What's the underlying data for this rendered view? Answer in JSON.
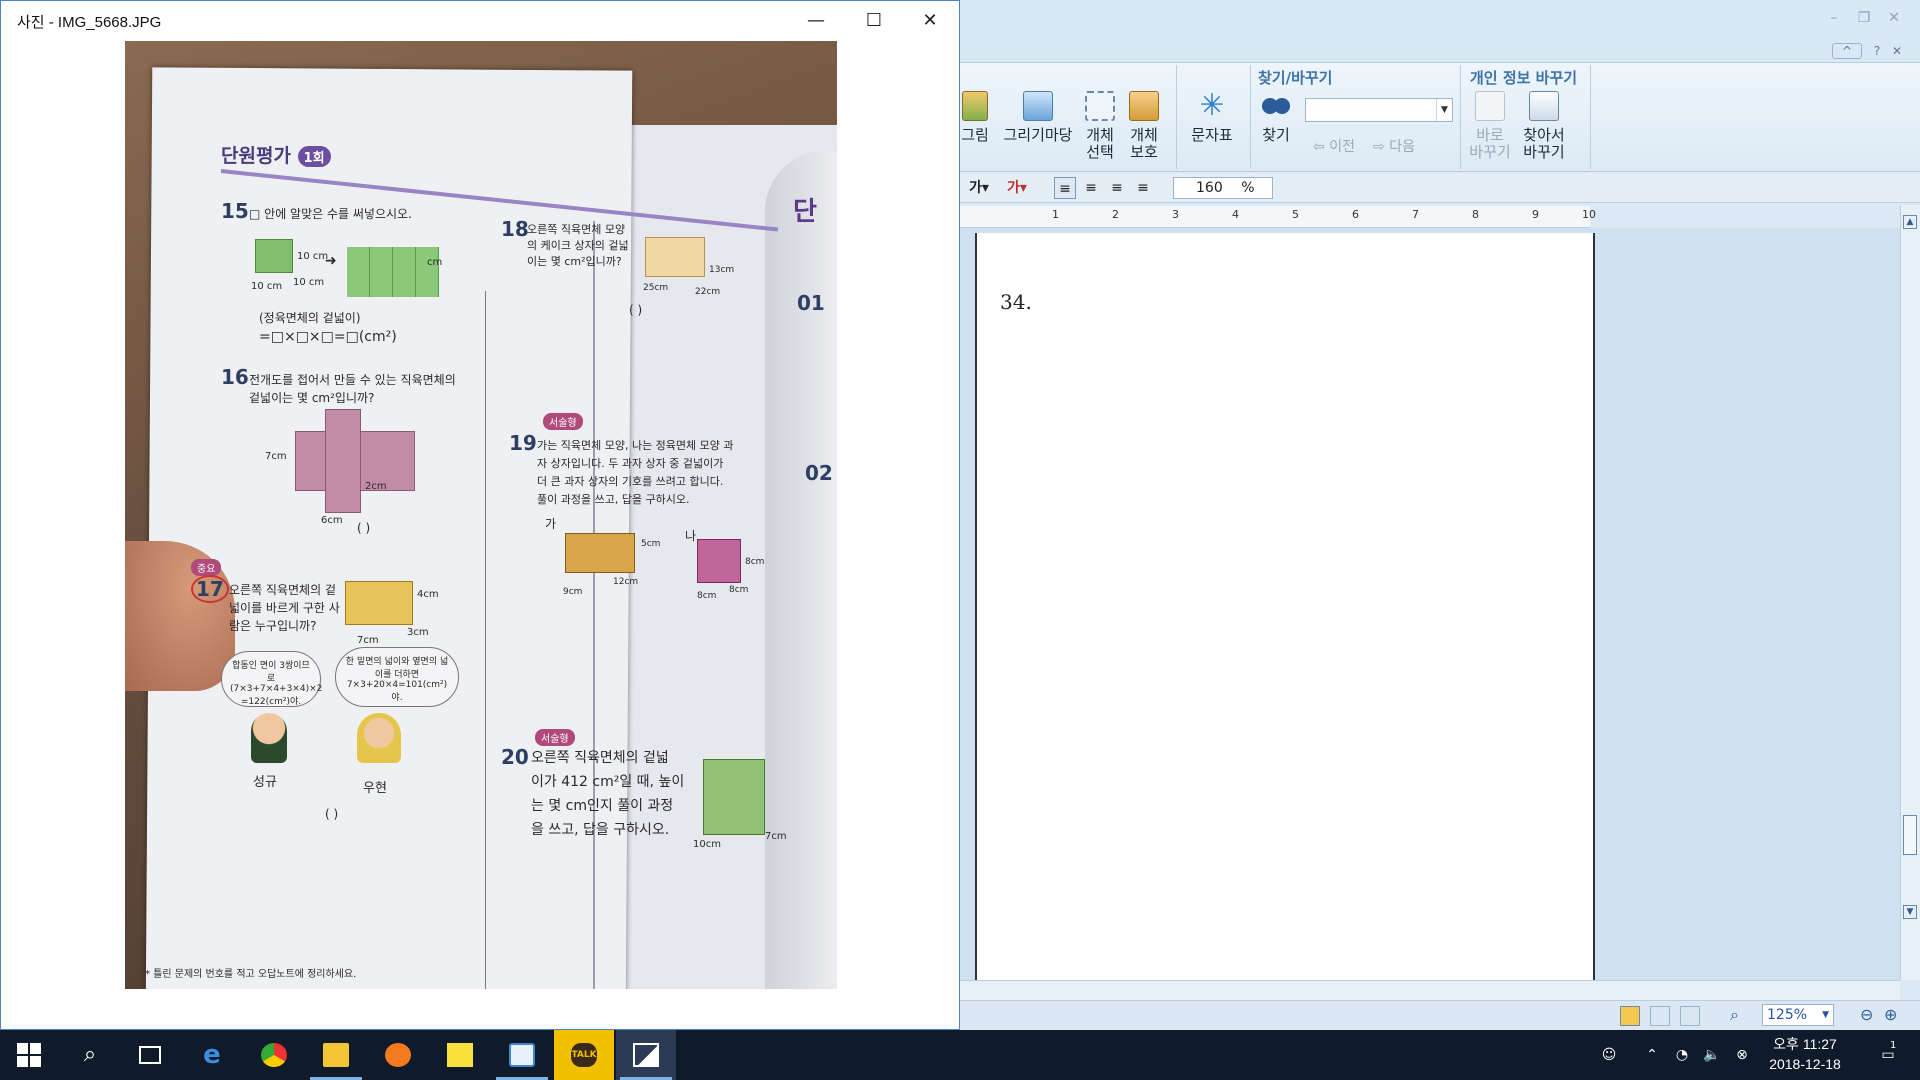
{
  "photos_window": {
    "title": "사진 - IMG_5668.JPG",
    "minimize_label": "—",
    "maximize_label": "☐",
    "close_label": "✕"
  },
  "photo_content": {
    "unit_title": "단원평가",
    "unit_round": "1회",
    "q15_num": "15",
    "q15_text": "□ 안에 알맞은 수를 써넣으시오.",
    "q15_formula_label": "(정육면체의 겉넓이)",
    "q15_formula": "=□×□×□=□(cm²)",
    "q15_dim_a": "10 cm",
    "q15_dim_b": "10 cm",
    "q15_dim_c": "10 cm",
    "q15_dim_d": "cm",
    "q16_num": "16",
    "q16_text_1": "전개도를 접어서 만들 수 있는 직육면체의",
    "q16_text_2": "겉넓이는 몇 cm²입니까?",
    "q16_dim_a": "7cm",
    "q16_dim_b": "2cm",
    "q16_dim_c": "6cm",
    "q16_answer": "(                    )",
    "q17_tag": "중요",
    "q17_num": "17",
    "q17_text_1": "오른쪽 직육면체의 겉",
    "q17_text_2": "넓이를 바르게 구한 사",
    "q17_text_3": "람은 누구입니까?",
    "q17_dim_a": "4cm",
    "q17_dim_b": "3cm",
    "q17_dim_c": "7cm",
    "q17_bubble_1": "합동인 면이 3쌍이므로 (7×3+7×4+3×4)×2 =122(cm²)야.",
    "q17_bubble_2": "한 밑면의 넓이와 옆면의 넓이를 더하면 7×3+20×4=101(cm²)야.",
    "q17_name_1": "성규",
    "q17_name_2": "우현",
    "q17_answer": "(                    )",
    "q18_num": "18",
    "q18_text_1": "오른쪽 직육면체 모양",
    "q18_text_2": "의 케이크 상자의 겉넓",
    "q18_text_3": "이는 몇 cm²입니까?",
    "q18_dim_a": "25cm",
    "q18_dim_b": "22cm",
    "q18_dim_c": "13cm",
    "q18_answer": "(                    )",
    "q19_tag": "서술형",
    "q19_num": "19",
    "q19_text_1": "가는 직육면체 모양, 나는 정육면체 모양 과",
    "q19_text_2": "자 상자입니다. 두 과자 상자 중 겉넓이가",
    "q19_text_3": "더 큰 과자 상자의 기호를 쓰려고 합니다.",
    "q19_text_4": "풀이 과정을 쓰고, 답을 구하시오.",
    "q19_label_a": "가",
    "q19_label_b": "나",
    "q19_dim_a": "5cm",
    "q19_dim_b": "12cm",
    "q19_dim_c": "9cm",
    "q19_dim_d": "8cm",
    "q19_dim_e": "8cm",
    "q19_dim_f": "8cm",
    "q20_tag": "서술형",
    "q20_num": "20",
    "q20_text_1": "오른쪽 직육면체의 겉넓",
    "q20_text_2": "이가 412 cm²일 때, 높이",
    "q20_text_3": "는 몇 cm인지 풀이 과정",
    "q20_text_4": "을 쓰고, 답을 구하시오.",
    "q20_dim_a": "10cm",
    "q20_dim_b": "7cm",
    "right_page_title": "단",
    "right_page_num_1": "01",
    "right_page_num_2": "02",
    "footer_note": "* 틀린 문제의 번호를 적고 오답노트에 정리하세요."
  },
  "hwp": {
    "ribbon": {
      "btn_picture": "그림",
      "btn_drawing": "그리기마당",
      "btn_select_obj_1": "개체",
      "btn_select_obj_2": "선택",
      "btn_protect_obj_1": "개체",
      "btn_protect_obj_2": "보호",
      "btn_charmap": "문자표",
      "group_find": "찾기/바꾸기",
      "btn_find": "찾기",
      "btn_prev": "이전",
      "btn_next": "다음",
      "group_privacy": "개인 정보 바꾸기",
      "btn_replace_now_1": "바로",
      "btn_replace_now_2": "바꾸기",
      "btn_find_replace_1": "찾아서",
      "btn_find_replace_2": "바꾸기"
    },
    "format": {
      "font_glyph": "가",
      "color_glyph": "가",
      "line_spacing": "160",
      "line_spacing_unit": "%"
    },
    "ruler_numbers": [
      "1",
      "2",
      "3",
      "4",
      "5",
      "6",
      "7",
      "8",
      "9",
      "10"
    ],
    "document_text": "34.",
    "status_zoom": "125%",
    "help_label": "?",
    "close_label": "✕"
  },
  "taskbar": {
    "clock_time": "오후 11:27",
    "clock_date": "2018-12-18",
    "notification_count": "1",
    "icons": [
      "start-icon",
      "search-icon",
      "task-view-icon",
      "edge-icon",
      "chrome-icon",
      "file-explorer-icon",
      "pen-app-icon",
      "sticky-notes-icon",
      "hwp-icon",
      "kakaotalk-icon",
      "photos-icon"
    ],
    "kakao_label": "TALK"
  },
  "colors": {
    "taskbar_bg": "#0f1a2b",
    "hwp_ribbon_accent": "#3e73a8",
    "photos_border": "#4b87c8"
  }
}
